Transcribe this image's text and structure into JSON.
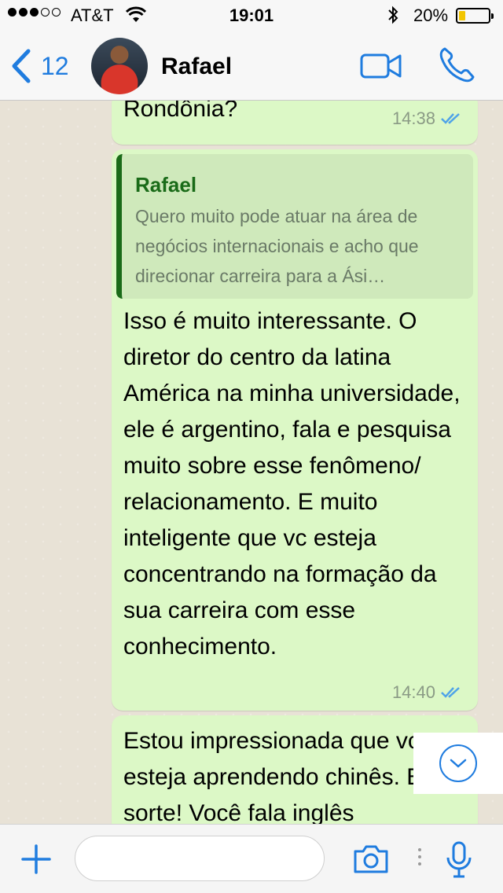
{
  "status_bar": {
    "carrier": "AT&T",
    "time": "19:01",
    "battery": "20%",
    "battery_level": 0.2
  },
  "header": {
    "back_count": "12",
    "contact_name": "Rafael"
  },
  "messages": [
    {
      "text": "Rondônia?",
      "time": "14:38",
      "status": "read"
    },
    {
      "quote_author": "Rafael",
      "quote_text": "Quero muito pode atuar na área de negócios internacionais e acho que direcionar carreira para a Ási…",
      "text": "Isso é muito interessante. O diretor do centro da latina América na minha universidade, ele é argentino, fala e pesquisa muito sobre esse fenômeno/ relacionamento. E muito inteligente que vc esteja concentrando na formação da sua carreira com esse conhecimento.",
      "time": "14:40",
      "status": "read"
    },
    {
      "text": "Estou impressionada que vc esteja aprendendo chinês. Boa sorte! Você fala inglês"
    }
  ],
  "input": {
    "placeholder": ""
  },
  "colors": {
    "accent": "#1f7cdf",
    "bubble": "#dcf8c6",
    "quote_bar": "#1a6b18"
  },
  "icons": [
    "back-chevron-icon",
    "video-call-icon",
    "phone-call-icon",
    "read-receipt-icon",
    "scroll-down-icon",
    "plus-icon",
    "camera-icon",
    "microphone-icon"
  ]
}
